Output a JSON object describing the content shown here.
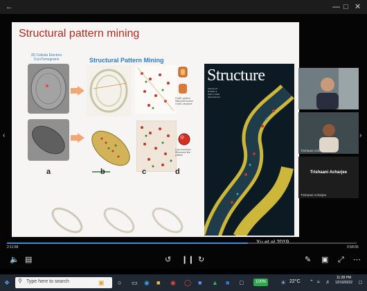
{
  "slide": {
    "title": "Structural pattern mining",
    "cryo_label_line1": "3D Cellular Electron",
    "cryo_label_line2": "CryoTomograms",
    "spm_header": "Structural Pattern Mining",
    "panel_labels": [
      "a",
      "b",
      "c",
      "d"
    ],
    "annot1_line1": "GroEL pattern",
    "annot1_line2": "fitted with known",
    "annot1_line3": "GroEL structure",
    "annot2_line1": "Low resolution",
    "annot2_line2": "Ribosome like",
    "annot2_line3": "pattern",
    "cover_title": "Structure",
    "cover_meta_1": "Volume 27",
    "cover_meta_2": "Number 4",
    "cover_meta_3": "April 2, 2019",
    "cover_meta_4": "www.cell.com",
    "citation": "Xu et al 2019"
  },
  "participants": [
    {
      "name": "",
      "kind": "video"
    },
    {
      "name": "Trishaani Acharjee",
      "kind": "video"
    },
    {
      "name": "Trishaani Acharjee",
      "kind": "avatar",
      "sub": "Trishaani Acharjee"
    }
  ],
  "player": {
    "time_elapsed": "2:11:58",
    "time_remaining": "0:58:55",
    "progress_fraction": 0.69
  },
  "taskbar": {
    "search_placeholder": "Type here to search",
    "battery": "100%",
    "temperature": "22°C",
    "clock_time": "11:28 PM",
    "clock_date": "12/10/2022"
  },
  "colors": {
    "title_red": "#b8271c",
    "accent_blue": "#2e7bc4",
    "progress_blue": "#3a8ee6"
  }
}
